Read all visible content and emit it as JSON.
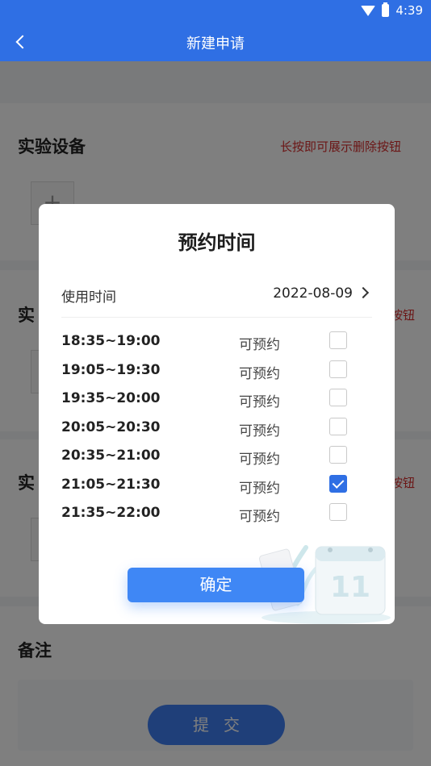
{
  "status_bar": {
    "time": "4:39"
  },
  "header": {
    "title": "新建申请"
  },
  "sections": {
    "equipment_title": "实验设备",
    "delete_hint": "长按即可展示删除按钮",
    "partial_title_2": "实",
    "partial_hint_2": "按钮",
    "partial_title_3": "实",
    "partial_hint_3": "按钮",
    "remark_title": "备注",
    "submit_label": "提交"
  },
  "dialog": {
    "title": "预约时间",
    "date_label": "使用时间",
    "date_value": "2022-08-09",
    "slots": [
      {
        "time": "18:35~19:00",
        "status": "可预约",
        "checked": false
      },
      {
        "time": "19:05~19:30",
        "status": "可预约",
        "checked": false
      },
      {
        "time": "19:35~20:00",
        "status": "可预约",
        "checked": false
      },
      {
        "time": "20:05~20:30",
        "status": "可预约",
        "checked": false
      },
      {
        "time": "20:35~21:00",
        "status": "可预约",
        "checked": false
      },
      {
        "time": "21:05~21:30",
        "status": "可预约",
        "checked": true
      },
      {
        "time": "21:35~22:00",
        "status": "可预约",
        "checked": false
      }
    ],
    "confirm_label": "确定",
    "calendar_number": "11"
  },
  "colors": {
    "primary": "#2f6fe4",
    "button": "#3f87f5",
    "hint_red": "#d62c2c"
  }
}
